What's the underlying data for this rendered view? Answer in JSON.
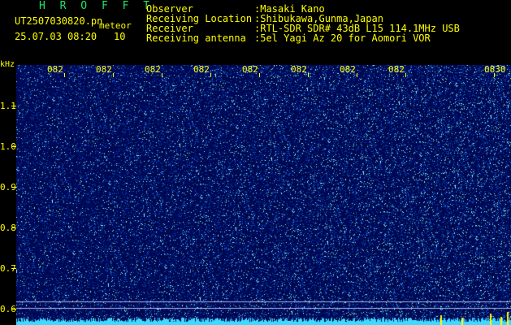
{
  "header": {
    "brand": "H R O F F T",
    "filename": "UT2507030820.pn",
    "label": "meteor",
    "datetime": "25.07.03 08:20",
    "count": "10",
    "info": [
      {
        "label": "Observer",
        "value": ":Masaki Kano"
      },
      {
        "label": "Receiving Location",
        "value": ":Shibukawa,Gunma,Japan"
      },
      {
        "label": "Receiver",
        "value": ":RTL-SDR SDR# 43dB L15 114.1MHz USB"
      },
      {
        "label": "Receiving antenna",
        "value": ":5el Yagi Az 20 for Aomori VOR"
      }
    ]
  },
  "axis": {
    "y_unit": "kHz",
    "y_ticks": [
      "1.1",
      "1.0",
      "0.9",
      "0.8",
      "0.7",
      "0.6"
    ],
    "x_ticks": [
      "082",
      "082",
      "082",
      "082",
      "082",
      "082",
      "082",
      "082",
      "0830"
    ]
  },
  "colors": {
    "background": "#000000",
    "text": "#ffff00",
    "brand": "#22e26a",
    "spectrogram_base": "#000a55",
    "signal": "#3fd8ff"
  }
}
